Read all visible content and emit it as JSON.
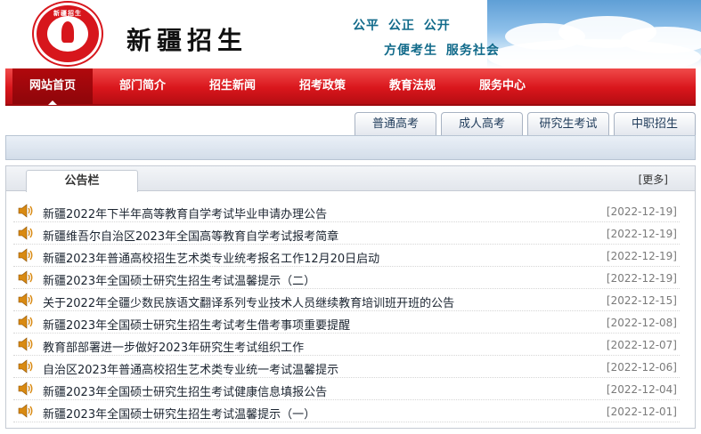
{
  "header": {
    "logo_text": "新疆招生",
    "site_title": "新疆招生",
    "slogan_line1": "公平 公正 公开",
    "slogan_line2": "方便考生 服务社会"
  },
  "nav": {
    "items": [
      {
        "label": "网站首页",
        "active": true
      },
      {
        "label": "部门简介",
        "active": false
      },
      {
        "label": "招生新闻",
        "active": false
      },
      {
        "label": "招考政策",
        "active": false
      },
      {
        "label": "教育法规",
        "active": false
      },
      {
        "label": "服务中心",
        "active": false
      }
    ]
  },
  "subtabs": [
    "普通高考",
    "成人高考",
    "研究生考试",
    "中职招生"
  ],
  "board": {
    "tab_label": "公告栏",
    "more_label": "[更多]",
    "items": [
      {
        "title": "新疆2022年下半年高等教育自学考试毕业申请办理公告",
        "date": "[2022-12-19]"
      },
      {
        "title": "新疆维吾尔自治区2023年全国高等教育自学考试报考简章",
        "date": "[2022-12-19]"
      },
      {
        "title": "新疆2023年普通高校招生艺术类专业统考报名工作12月20日启动",
        "date": "[2022-12-19]"
      },
      {
        "title": "新疆2023年全国硕士研究生招生考试温馨提示（二）",
        "date": "[2022-12-19]"
      },
      {
        "title": "关于2022年全疆少数民族语文翻译系列专业技术人员继续教育培训班开班的公告",
        "date": "[2022-12-15]"
      },
      {
        "title": "新疆2023年全国硕士研究生招生考试考生借考事项重要提醒",
        "date": "[2022-12-08]"
      },
      {
        "title": "教育部部署进一步做好2023年研究生考试组织工作",
        "date": "[2022-12-07]"
      },
      {
        "title": "自治区2023年普通高校招生艺术类专业统一考试温馨提示",
        "date": "[2022-12-06]"
      },
      {
        "title": "新疆2023年全国硕士研究生招生考试健康信息填报公告",
        "date": "[2022-12-04]"
      },
      {
        "title": "新疆2023年全国硕士研究生招生考试温馨提示（一）",
        "date": "[2022-12-01]"
      }
    ]
  },
  "colors": {
    "nav_red": "#d9161c",
    "slogan_teal": "#116a8a",
    "speaker_orange": "#d98a12"
  }
}
